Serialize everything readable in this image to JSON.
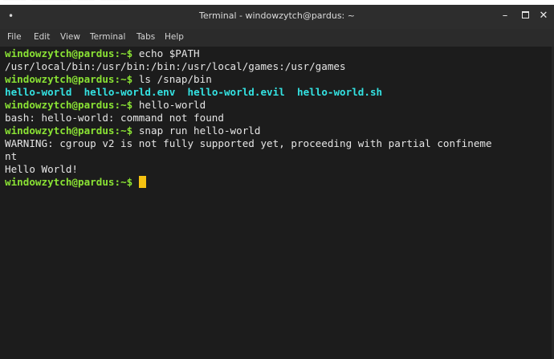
{
  "window": {
    "title": "Terminal - windowzytch@pardus: ~",
    "menu_icon": "window-menu-dot",
    "minimize_icon": "minimize-icon",
    "maximize_icon": "maximize-icon",
    "close_icon": "close-icon"
  },
  "menubar": {
    "items": [
      "File",
      "Edit",
      "View",
      "Terminal",
      "Tabs",
      "Help"
    ]
  },
  "terminal": {
    "colors": {
      "background": "#1c1c1c",
      "text": "#e5e5e5",
      "prompt": "#8ae234",
      "executable": "#34e2e2",
      "cursor": "#f5c211"
    },
    "lines": [
      {
        "prompt": "windowzytch@pardus",
        "path": ":~$",
        "cmd": " echo $PATH"
      },
      {
        "text": "/usr/local/bin:/usr/bin:/bin:/usr/local/games:/usr/games"
      },
      {
        "prompt": "windowzytch@pardus",
        "path": ":~$",
        "cmd": " ls /snap/bin"
      },
      {
        "ls": [
          "hello-world",
          "hello-world.env",
          "hello-world.evil",
          "hello-world.sh"
        ]
      },
      {
        "prompt": "windowzytch@pardus",
        "path": ":~$",
        "cmd": " hello-world"
      },
      {
        "text": "bash: hello-world: command not found"
      },
      {
        "prompt": "windowzytch@pardus",
        "path": ":~$",
        "cmd": " snap run hello-world"
      },
      {
        "text": "WARNING: cgroup v2 is not fully supported yet, proceeding with partial confineme"
      },
      {
        "text": "nt"
      },
      {
        "text": "Hello World!"
      },
      {
        "prompt": "windowzytch@pardus",
        "path": ":~$",
        "cmd": " "
      }
    ]
  }
}
